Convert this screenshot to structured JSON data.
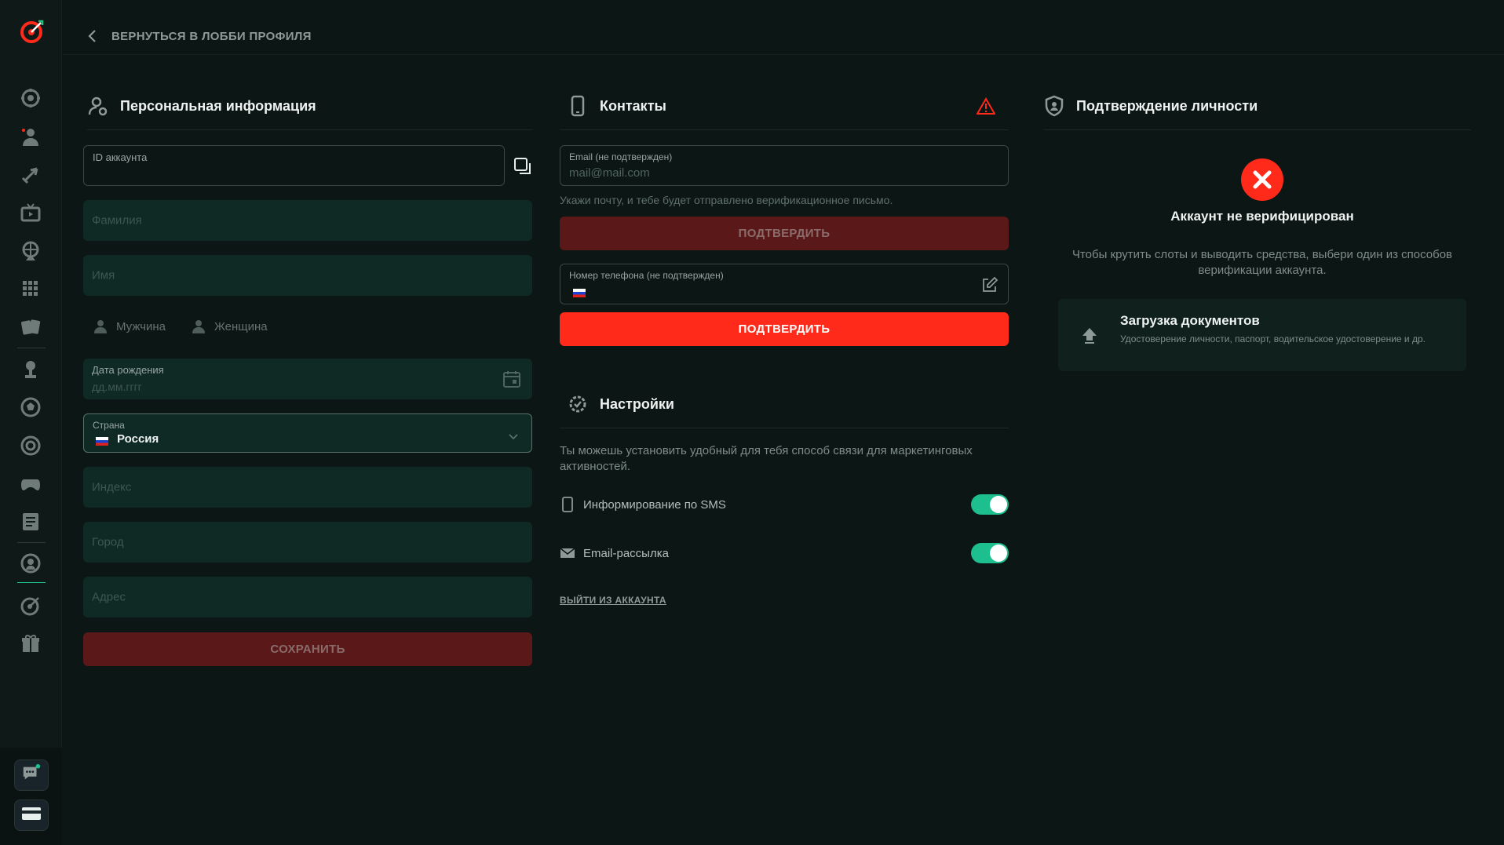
{
  "nav": {
    "back_label": "ВЕРНУТЬСЯ В ЛОББИ ПРОФИЛЯ",
    "sidebar_icons": [
      "casino-chip-icon",
      "user-icon",
      "rocket-icon",
      "tv-icon",
      "wheel-icon",
      "lottery-icon",
      "cards-icon",
      "trophy-icon",
      "football-icon",
      "target-icon",
      "gamepad-icon",
      "news-icon",
      "live-sport-icon",
      "darts-icon",
      "gift-icon"
    ],
    "bottom_icons": [
      "chat-icon",
      "payment-card-icon"
    ]
  },
  "personal": {
    "title": "Персональная информация",
    "account_id_label": "ID аккаунта",
    "lastname_placeholder": "Фамилия",
    "firstname_placeholder": "Имя",
    "male_label": "Мужчина",
    "female_label": "Женщина",
    "birthdate_label": "Дата рождения",
    "birthdate_placeholder": "дд.мм.гггг",
    "country_label": "Страна",
    "country_value": "Россия",
    "zip_placeholder": "Индекс",
    "city_placeholder": "Город",
    "address_placeholder": "Адрес",
    "save_label": "СОХРАНИТЬ"
  },
  "contacts": {
    "title": "Контакты",
    "email_label": "Email (не подтвержден)",
    "email_placeholder": "mail@mail.com",
    "email_helper": "Укажи почту, и тебе будет отправлено верификационное письмо.",
    "confirm_email_label": "ПОДТВЕРДИТЬ",
    "phone_label": "Номер телефона (не подтвержден)",
    "confirm_phone_label": "ПОДТВЕРДИТЬ"
  },
  "settings": {
    "title": "Настройки",
    "description": "Ты можешь установить удобный для тебя способ связи для маркетинговых активностей.",
    "sms_label": "Информирование по SMS",
    "sms_enabled": true,
    "email_label": "Email-рассылка",
    "email_enabled": true,
    "logout_label": "ВЫЙТИ ИЗ АККАУНТА"
  },
  "verification": {
    "title": "Подтверждение личности",
    "status": "Аккаунт не верифицирован",
    "description": "Чтобы крутить слоты и выводить средства, выбери один из способов верификации аккаунта.",
    "upload_title": "Загрузка документов",
    "upload_subtitle": "Удостоверение личности, паспорт, водительское удостоверение и др."
  },
  "colors": {
    "background": "#0c1614",
    "accent_red": "#ff2a1a",
    "toggle_green": "#1dbf8f",
    "field_bg": "#0f2a24"
  }
}
